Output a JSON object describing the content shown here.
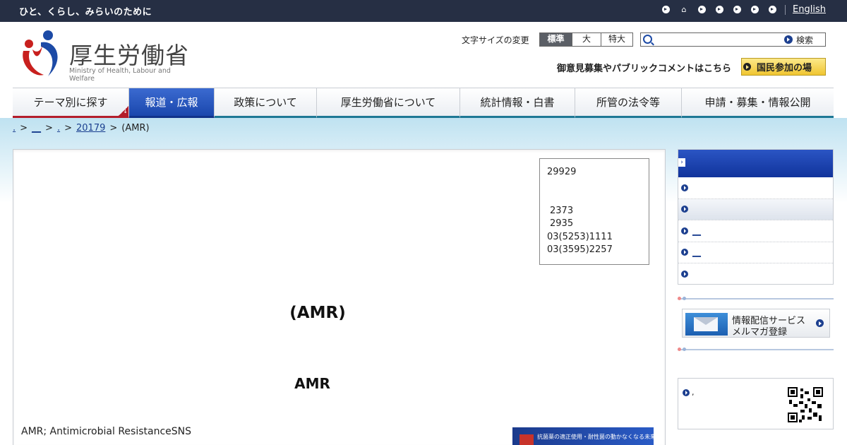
{
  "topbar": {
    "tagline": "ひと、くらし、みらいのために",
    "english_label": "English"
  },
  "header": {
    "logo_kanji": "厚生労働省",
    "logo_sub": "Ministry of Health, Labour and Welfare",
    "fontsize_label": "文字サイズの変更",
    "fontsize_options": [
      "標準",
      "大",
      "特大"
    ],
    "fontsize_selected": "標準",
    "search_placeholder": "",
    "search_button": "検索",
    "opinion_text": "御意見募集やパブリックコメントはこちら",
    "kokumin_button": "国民参加の場"
  },
  "gnav": {
    "items": [
      "テーマ別に探す",
      "報道・広報",
      "政策について",
      "厚生労働省について",
      "統計情報・白書",
      "所管の法令等",
      "申請・募集・情報公開"
    ],
    "active": "報道・広報"
  },
  "breadcrumb": {
    "sep": ">",
    "items": [
      ".",
      "__",
      ".",
      "20179",
      "(AMR)"
    ]
  },
  "contact": {
    "line1": "29929",
    "line2": "2373",
    "line3": "2935",
    "line4": "03(5253)1111",
    "line5": "03(3595)2257"
  },
  "content": {
    "title1": "(AMR)",
    "title2": "AMR",
    "body": "AMR; Antimicrobial ResistanceSNS",
    "banner_text": "抗菌薬の適正使用・耐性菌の動かなくなる未来に立ち向かおう"
  },
  "sidebar": {
    "rows": [
      "",
      "",
      "__",
      "__",
      ""
    ],
    "mail_line1": "情報配信サービス",
    "mail_line2": "メルマガ登録",
    "qr_text": ","
  },
  "colors": {
    "topbar": "#262f44",
    "nav_active": "#1a47ad",
    "nav_underline": "#1d7895",
    "nav_red": "#b31d2b"
  }
}
